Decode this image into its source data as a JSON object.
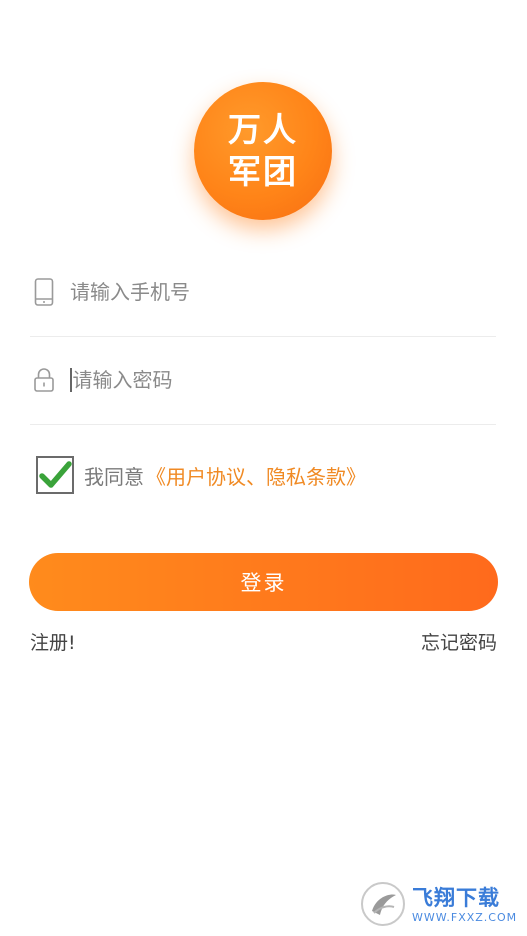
{
  "logo": {
    "line1": "万人",
    "line2": "军团"
  },
  "phone_field": {
    "icon": "phone-icon",
    "placeholder": "请输入手机号",
    "value": ""
  },
  "password_field": {
    "icon": "lock-icon",
    "placeholder": "请输入密码",
    "value": ""
  },
  "agreement": {
    "checked": true,
    "text": "我同意",
    "link_text": "《用户协议、隐私条款》"
  },
  "login_button": {
    "label": "登录"
  },
  "links": {
    "register": "注册!",
    "forgot": "忘记密码"
  },
  "watermark": {
    "title": "飞翔下载",
    "url": "WWW.FXXZ.COM"
  },
  "colors": {
    "accent": "#ff7e1a",
    "link": "#f08a24",
    "check": "#3aa33a"
  }
}
